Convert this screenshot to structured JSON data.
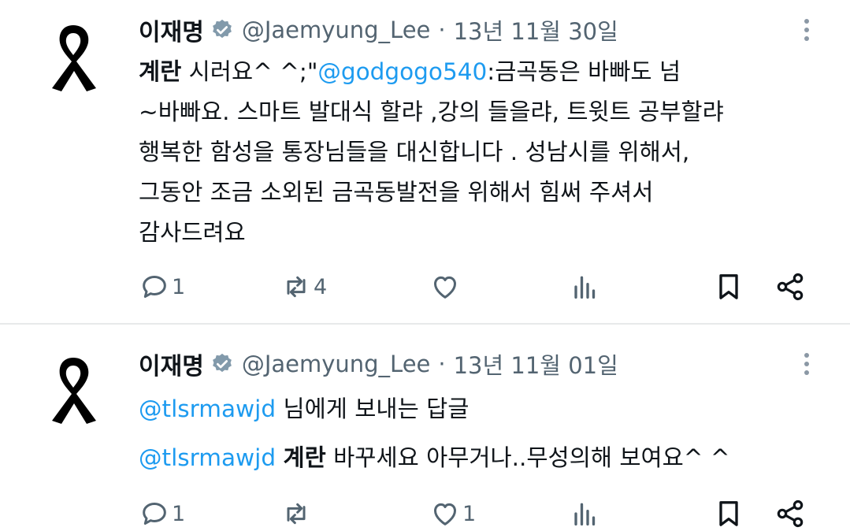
{
  "tweets": [
    {
      "author": {
        "name": "이재명",
        "handle": "@Jaemyung_Lee",
        "date": "13년 11월 30일"
      },
      "lines": {
        "l1": {
          "bold": "계란",
          "text1": " 시러요^ ^;\"",
          "link": "@godgogo540",
          "text2": ":금곡동은 바빠도 넘"
        },
        "l2": "~바빠요.  스마트 발대식 할랴 ,강의 들을랴,  트윗트 공부할랴",
        "l3": "행복한 함성을 통장님들을 대신합니다 . 성남시를 위해서,",
        "l4": "그동안 조금 소외된 금곡동발전을 위해서 힘써 주셔서",
        "l5": "감사드려요"
      },
      "actions": {
        "replies": "1",
        "retweets": "4",
        "likes": ""
      }
    },
    {
      "author": {
        "name": "이재명",
        "handle": "@Jaemyung_Lee",
        "date": "13년 11월 01일"
      },
      "reply_to": {
        "link": "@tlsrmawjd",
        "text": " 님에게 보내는 답글"
      },
      "lines": {
        "l1": {
          "link": "@tlsrmawjd",
          "bold": "계란",
          "text": " 바꾸세요 아무거나..무성의해 보여요^ ^"
        }
      },
      "actions": {
        "replies": "1",
        "retweets": "",
        "likes": "1"
      }
    }
  ],
  "colors": {
    "text": "#0f1419",
    "secondary": "#536471",
    "link": "#1d9bf0",
    "divider": "#e7e9ea"
  },
  "icons": [
    "black-ribbon-icon",
    "verified-badge-icon",
    "more-icon",
    "reply-icon",
    "retweet-icon",
    "like-icon",
    "views-icon",
    "bookmark-icon",
    "share-icon"
  ]
}
